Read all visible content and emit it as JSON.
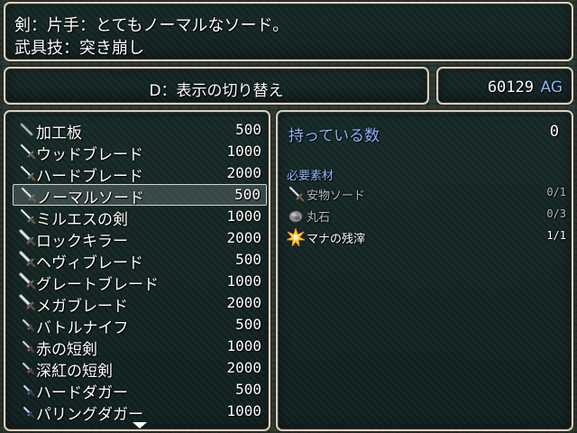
{
  "help": {
    "line1": "剣：片手：とてもノーマルなソード。",
    "line2": "武具技：突き崩し"
  },
  "toggle": {
    "label": "D：表示の切り替え"
  },
  "gold": {
    "value": "60129",
    "unit": "AG"
  },
  "items": [
    {
      "name": "加工板",
      "price": "500",
      "icon": "board-icon"
    },
    {
      "name": "ウッドブレード",
      "price": "1000",
      "icon": "sword-icon"
    },
    {
      "name": "ハードブレード",
      "price": "2000",
      "icon": "sword-icon"
    },
    {
      "name": "ノーマルソード",
      "price": "500",
      "icon": "sword-icon",
      "selected": true
    },
    {
      "name": "ミルエスの剣",
      "price": "1000",
      "icon": "sword-icon"
    },
    {
      "name": "ロックキラー",
      "price": "2000",
      "icon": "greatsword-icon"
    },
    {
      "name": "ヘヴィブレード",
      "price": "500",
      "icon": "greatsword-icon"
    },
    {
      "name": "グレートブレード",
      "price": "1000",
      "icon": "greatsword-icon"
    },
    {
      "name": "メガブレード",
      "price": "2000",
      "icon": "greatsword-icon"
    },
    {
      "name": "バトルナイフ",
      "price": "500",
      "icon": "knife-icon"
    },
    {
      "name": "赤の短剣",
      "price": "1000",
      "icon": "knife-icon"
    },
    {
      "name": "深紅の短剣",
      "price": "2000",
      "icon": "knife-icon"
    },
    {
      "name": "ハードダガー",
      "price": "500",
      "icon": "dagger-icon"
    },
    {
      "name": "パリングダガー",
      "price": "1000",
      "icon": "dagger-icon"
    }
  ],
  "detail": {
    "owned_label": "持っている数",
    "owned_value": "0",
    "materials_heading": "必要素材",
    "materials": [
      {
        "name": "安物ソード",
        "count": "0/1",
        "icon": "sword-icon",
        "met": false
      },
      {
        "name": "丸石",
        "count": "0/3",
        "icon": "stone-icon",
        "met": false
      },
      {
        "name": "マナの残滓",
        "count": "1/1",
        "icon": "sparkle-icon",
        "met": true
      }
    ]
  },
  "colors": {
    "frame": "#d7d2c4",
    "accent_text": "#8fb5ff",
    "window_bg": "#14282a"
  }
}
